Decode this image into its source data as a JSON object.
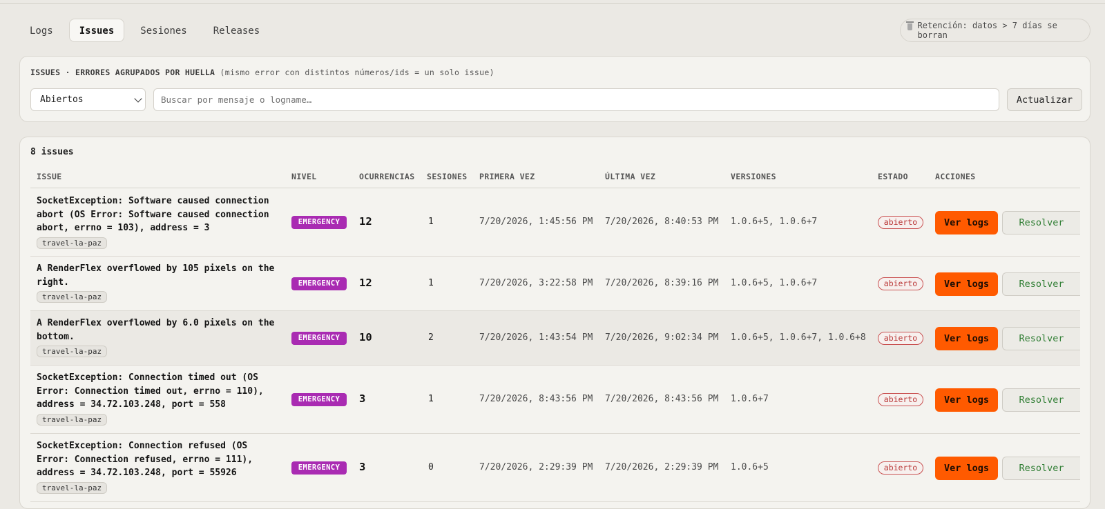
{
  "tabs": [
    {
      "label": "Logs",
      "active": false
    },
    {
      "label": "Issues",
      "active": true
    },
    {
      "label": "Sesiones",
      "active": false
    },
    {
      "label": "Releases",
      "active": false
    }
  ],
  "retention": {
    "icon": "trash-icon",
    "text": "Retención: datos > 7 días se borran"
  },
  "filters": {
    "title": "ISSUES · ERRORES AGRUPADOS POR HUELLA",
    "subtitle": "(mismo error con distintos números/ids = un solo issue)",
    "status_select": "Abiertos",
    "search_placeholder": "Buscar por mensaje o logname…",
    "refresh_label": "Actualizar"
  },
  "list": {
    "count": "8 issues",
    "columns": {
      "issue": "ISSUE",
      "level": "NIVEL",
      "occurrences": "OCURRENCIAS",
      "sessions": "SESIONES",
      "first_seen": "PRIMERA VEZ",
      "last_seen": "ÚLTIMA VEZ",
      "versions": "VERSIONES",
      "status": "ESTADO",
      "actions": "ACCIONES"
    },
    "rows": [
      {
        "line1": "SocketException: Software caused connection",
        "line2": "abort (OS Error: Software caused connection",
        "line3": "abort, errno = 103), address = 3",
        "tag": "travel-la-paz",
        "level": "EMERGENCY",
        "occurrences": "12",
        "sessions": "1",
        "first_seen": "7/20/2026, 1:45:56 PM",
        "last_seen": "7/20/2026, 8:40:53 PM",
        "versions": "1.0.6+5, 1.0.6+7",
        "status": "abierto",
        "view_logs": "Ver logs",
        "resolve": "Resolver"
      },
      {
        "line1": "A RenderFlex overflowed by 105 pixels on the",
        "line2": "right.",
        "line3": "",
        "tag": "travel-la-paz",
        "level": "EMERGENCY",
        "occurrences": "12",
        "sessions": "1",
        "first_seen": "7/20/2026, 3:22:58 PM",
        "last_seen": "7/20/2026, 8:39:16 PM",
        "versions": "1.0.6+5, 1.0.6+7",
        "status": "abierto",
        "view_logs": "Ver logs",
        "resolve": "Resolver"
      },
      {
        "line1": "A RenderFlex overflowed by 6.0 pixels on the",
        "line2": "bottom.",
        "line3": "",
        "tag": "travel-la-paz",
        "level": "EMERGENCY",
        "occurrences": "10",
        "sessions": "2",
        "first_seen": "7/20/2026, 1:43:54 PM",
        "last_seen": "7/20/2026, 9:02:34 PM",
        "versions": "1.0.6+5, 1.0.6+7, 1.0.6+8",
        "status": "abierto",
        "view_logs": "Ver logs",
        "resolve": "Resolver"
      },
      {
        "line1": "SocketException: Connection timed out (OS",
        "line2": "Error: Connection timed out, errno = 110),",
        "line3": "address = 34.72.103.248, port = 558",
        "tag": "travel-la-paz",
        "level": "EMERGENCY",
        "occurrences": "3",
        "sessions": "1",
        "first_seen": "7/20/2026, 8:43:56 PM",
        "last_seen": "7/20/2026, 8:43:56 PM",
        "versions": "1.0.6+7",
        "status": "abierto",
        "view_logs": "Ver logs",
        "resolve": "Resolver"
      },
      {
        "line1": "SocketException: Connection refused (OS",
        "line2": "Error: Connection refused, errno = 111),",
        "line3": "address = 34.72.103.248, port = 55926",
        "tag": "travel-la-paz",
        "level": "EMERGENCY",
        "occurrences": "3",
        "sessions": "0",
        "first_seen": "7/20/2026, 2:29:39 PM",
        "last_seen": "7/20/2026, 2:29:39 PM",
        "versions": "1.0.6+5",
        "status": "abierto",
        "view_logs": "Ver logs",
        "resolve": "Resolver"
      }
    ]
  },
  "colors": {
    "background": "#ebe9e4",
    "level_emergency": "#a92bb2",
    "primary_button": "#ff5a00",
    "status_open": "#b93636",
    "resolve_text": "#2e7d32"
  }
}
